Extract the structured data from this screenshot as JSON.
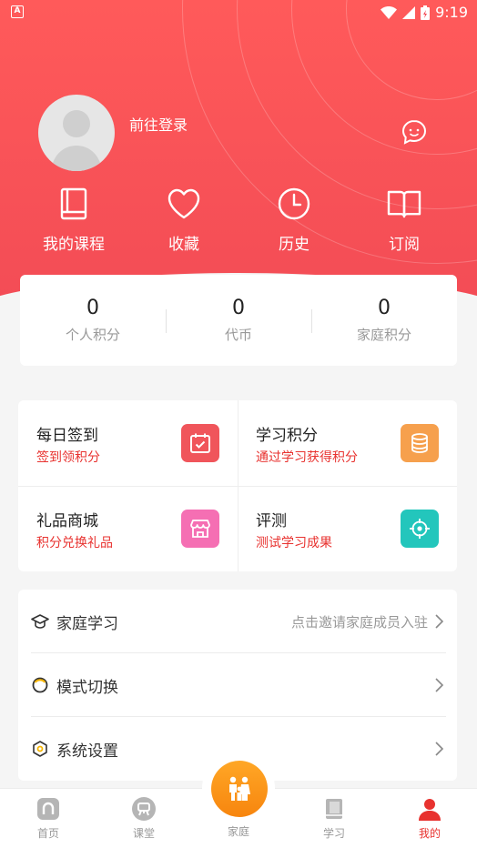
{
  "status_bar": {
    "time": "9:19"
  },
  "profile": {
    "login_text": "前往登录"
  },
  "quick_actions": [
    {
      "label": "我的课程",
      "icon": "book-icon"
    },
    {
      "label": "收藏",
      "icon": "heart-icon"
    },
    {
      "label": "历史",
      "icon": "clock-icon"
    },
    {
      "label": "订阅",
      "icon": "open-book-icon"
    }
  ],
  "stats": [
    {
      "value": "0",
      "label": "个人积分"
    },
    {
      "value": "0",
      "label": "代币"
    },
    {
      "value": "0",
      "label": "家庭积分"
    }
  ],
  "features": [
    {
      "title": "每日签到",
      "subtitle": "签到领积分",
      "icon": "calendar-check-icon",
      "color": "#f0555b"
    },
    {
      "title": "学习积分",
      "subtitle": "通过学习获得积分",
      "icon": "coins-icon",
      "color": "#f6a04d"
    },
    {
      "title": "礼品商城",
      "subtitle": "积分兑换礼品",
      "icon": "shop-icon",
      "color": "#f56fb3"
    },
    {
      "title": "评测",
      "subtitle": "测试学习成果",
      "icon": "target-icon",
      "color": "#23c6bc"
    }
  ],
  "settings": [
    {
      "label": "家庭学习",
      "hint": "点击邀请家庭成员入驻",
      "icon": "graduation-cap-icon"
    },
    {
      "label": "模式切换",
      "hint": "",
      "icon": "ring-icon"
    },
    {
      "label": "系统设置",
      "hint": "",
      "icon": "hexagon-icon"
    }
  ],
  "tabbar": {
    "items": [
      {
        "label": "首页",
        "icon": "home-icon"
      },
      {
        "label": "课堂",
        "icon": "classroom-icon"
      },
      {
        "label": "家庭",
        "icon": "family-icon"
      },
      {
        "label": "学习",
        "icon": "study-book-icon"
      },
      {
        "label": "我的",
        "icon": "user-icon"
      }
    ],
    "active": "我的"
  },
  "colors": {
    "brand_red": "#f24b55",
    "accent_text": "#e8322f",
    "center_orange": "#f7850e"
  }
}
